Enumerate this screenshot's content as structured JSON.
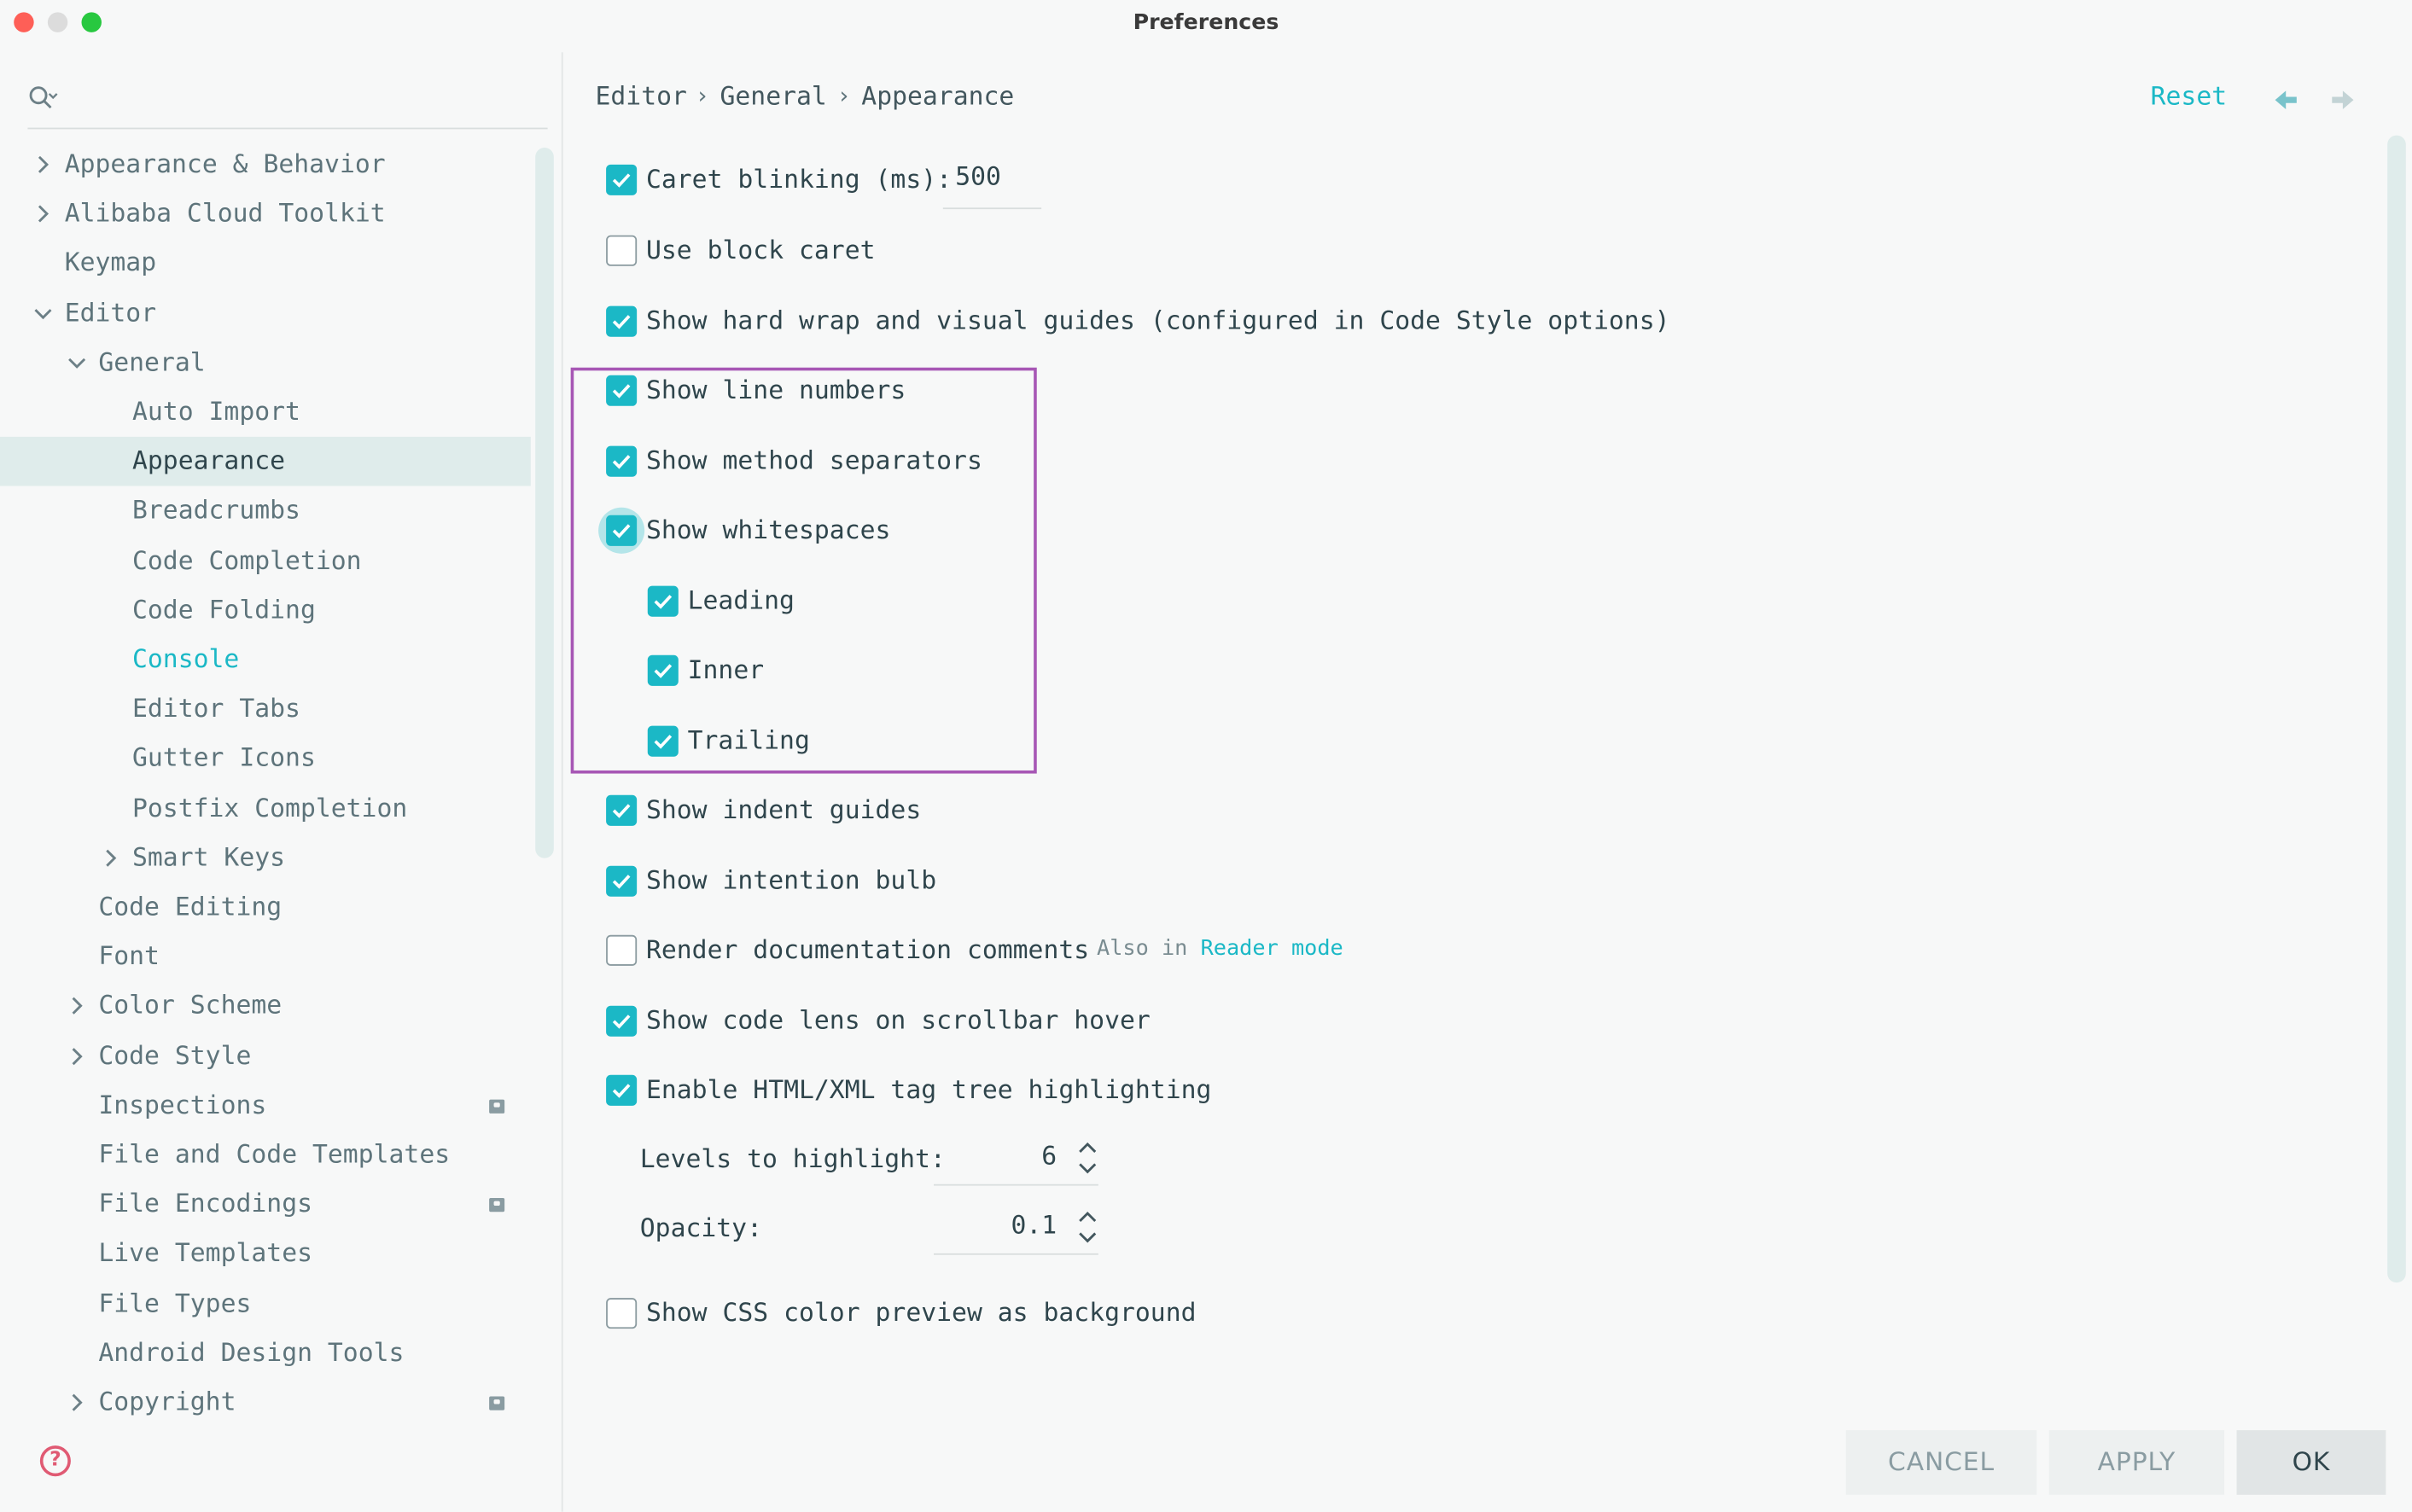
{
  "window": {
    "title": "Preferences"
  },
  "colors": {
    "accent": "#1bb8c6",
    "highlight_box": "#a757b5",
    "selected_row": "#dfeceb"
  },
  "sidebar": {
    "search_icon": "search-icon",
    "items": [
      {
        "label": "Appearance & Behavior",
        "level": 0,
        "expander": "collapsed"
      },
      {
        "label": "Alibaba Cloud Toolkit",
        "level": 0,
        "expander": "collapsed"
      },
      {
        "label": "Keymap",
        "level": 0,
        "expander": "none"
      },
      {
        "label": "Editor",
        "level": 0,
        "expander": "expanded"
      },
      {
        "label": "General",
        "level": 1,
        "expander": "expanded"
      },
      {
        "label": "Auto Import",
        "level": 2,
        "expander": "none"
      },
      {
        "label": "Appearance",
        "level": 2,
        "expander": "none",
        "selected": true
      },
      {
        "label": "Breadcrumbs",
        "level": 2,
        "expander": "none"
      },
      {
        "label": "Code Completion",
        "level": 2,
        "expander": "none"
      },
      {
        "label": "Code Folding",
        "level": 2,
        "expander": "none"
      },
      {
        "label": "Console",
        "level": 2,
        "expander": "none",
        "link": true
      },
      {
        "label": "Editor Tabs",
        "level": 2,
        "expander": "none"
      },
      {
        "label": "Gutter Icons",
        "level": 2,
        "expander": "none"
      },
      {
        "label": "Postfix Completion",
        "level": 2,
        "expander": "none"
      },
      {
        "label": "Smart Keys",
        "level": 2,
        "expander": "collapsed"
      },
      {
        "label": "Code Editing",
        "level": 1,
        "expander": "none"
      },
      {
        "label": "Font",
        "level": 1,
        "expander": "none"
      },
      {
        "label": "Color Scheme",
        "level": 1,
        "expander": "collapsed"
      },
      {
        "label": "Code Style",
        "level": 1,
        "expander": "collapsed"
      },
      {
        "label": "Inspections",
        "level": 1,
        "expander": "none",
        "badge": true
      },
      {
        "label": "File and Code Templates",
        "level": 1,
        "expander": "none"
      },
      {
        "label": "File Encodings",
        "level": 1,
        "expander": "none",
        "badge": true
      },
      {
        "label": "Live Templates",
        "level": 1,
        "expander": "none"
      },
      {
        "label": "File Types",
        "level": 1,
        "expander": "none"
      },
      {
        "label": "Android Design Tools",
        "level": 1,
        "expander": "none"
      },
      {
        "label": "Copyright",
        "level": 1,
        "expander": "collapsed",
        "badge": true
      }
    ]
  },
  "breadcrumb": {
    "parts": [
      "Editor",
      "General",
      "Appearance"
    ],
    "separator": "›"
  },
  "header": {
    "reset_label": "Reset",
    "back_icon": "arrow-left-icon",
    "forward_icon": "arrow-right-icon"
  },
  "options": {
    "caret_blinking": {
      "label": "Caret blinking (ms):",
      "checked": true,
      "value": "500"
    },
    "block_caret": {
      "label": "Use block caret",
      "checked": false
    },
    "hard_wrap": {
      "label": "Show hard wrap and visual guides (configured in Code Style options)",
      "checked": true
    },
    "line_numbers": {
      "label": "Show line numbers",
      "checked": true
    },
    "method_separators": {
      "label": "Show method separators",
      "checked": true
    },
    "whitespaces": {
      "label": "Show whitespaces",
      "checked": true
    },
    "leading": {
      "label": "Leading",
      "checked": true
    },
    "inner": {
      "label": "Inner",
      "checked": true
    },
    "trailing": {
      "label": "Trailing",
      "checked": true
    },
    "indent_guides": {
      "label": "Show indent guides",
      "checked": true
    },
    "intention_bulb": {
      "label": "Show intention bulb",
      "checked": true
    },
    "render_docs": {
      "label": "Render documentation comments",
      "checked": false,
      "hint_prefix": "Also in",
      "hint_link": "Reader mode"
    },
    "code_lens": {
      "label": "Show code lens on scrollbar hover",
      "checked": true
    },
    "tag_tree": {
      "label": "Enable HTML/XML tag tree highlighting",
      "checked": true
    },
    "levels": {
      "label": "Levels to highlight:",
      "value": "6"
    },
    "opacity": {
      "label": "Opacity:",
      "value": "0.1"
    },
    "css_preview": {
      "label": "Show CSS color preview as background",
      "checked": false
    }
  },
  "buttons": {
    "cancel": "CANCEL",
    "apply": "APPLY",
    "ok": "OK"
  },
  "help_icon": "help-icon"
}
